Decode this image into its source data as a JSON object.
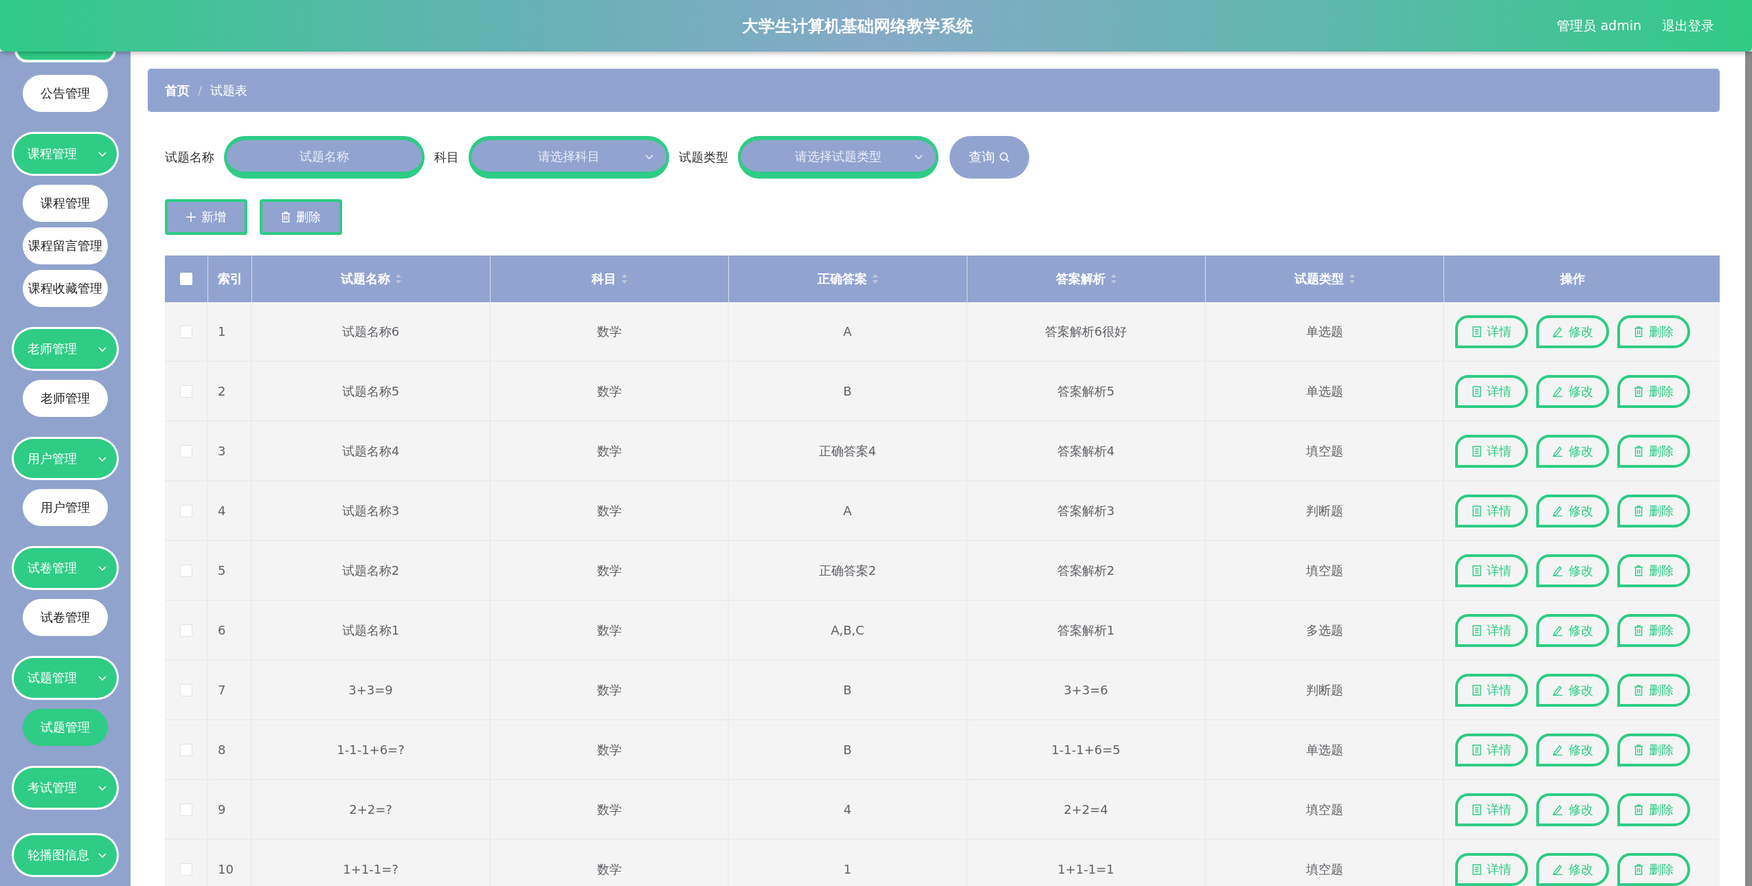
{
  "header": {
    "title": "大学生计算机基础网络教学系统",
    "user": "管理员 admin",
    "logout": "退出登录"
  },
  "sidebar": {
    "items": [
      {
        "kind": "item",
        "label": "公告管理",
        "selected": false
      },
      {
        "kind": "group",
        "label": "课程管理",
        "children": [
          {
            "label": "课程管理",
            "selected": false
          },
          {
            "label": "课程留言管理",
            "selected": false
          },
          {
            "label": "课程收藏管理",
            "selected": false
          }
        ]
      },
      {
        "kind": "group",
        "label": "老师管理",
        "children": [
          {
            "label": "老师管理",
            "selected": false
          }
        ]
      },
      {
        "kind": "group",
        "label": "用户管理",
        "children": [
          {
            "label": "用户管理",
            "selected": false
          }
        ]
      },
      {
        "kind": "group",
        "label": "试卷管理",
        "children": [
          {
            "label": "试卷管理",
            "selected": false
          }
        ]
      },
      {
        "kind": "group",
        "label": "试题管理",
        "children": [
          {
            "label": "试题管理",
            "selected": true
          }
        ]
      },
      {
        "kind": "group",
        "label": "考试管理"
      },
      {
        "kind": "group",
        "label": "轮播图信息"
      }
    ]
  },
  "breadcrumb": [
    {
      "label": "首页",
      "current": false
    },
    {
      "separator": "/",
      "label": "试题表",
      "current": true
    }
  ],
  "filters": [
    {
      "kind": "input",
      "label": "试题名称",
      "placeholder": "试题名称"
    },
    {
      "kind": "select",
      "label": "科目",
      "placeholder": "请选择科目"
    },
    {
      "kind": "select",
      "label": "试题类型",
      "placeholder": "请选择试题类型"
    }
  ],
  "search_button": "查询",
  "toolbar": [
    {
      "kind": "add",
      "label": "新增"
    },
    {
      "kind": "delete",
      "label": "删除"
    }
  ],
  "table": {
    "select_all": {
      "checked": false
    },
    "columns": [
      {
        "label": "索引",
        "sortable": false
      },
      {
        "label": "试题名称",
        "sortable": true
      },
      {
        "label": "科目",
        "sortable": true
      },
      {
        "label": "正确答案",
        "sortable": true
      },
      {
        "label": "答案解析",
        "sortable": true
      },
      {
        "label": "试题类型",
        "sortable": true
      },
      {
        "label": "操作",
        "sortable": false
      }
    ],
    "rows": [
      {
        "checked": false,
        "cells": [
          "1",
          "试题名称6",
          "数学",
          "A",
          "答案解析6很好",
          "单选题"
        ],
        "actions": [
          {
            "kind": "detail",
            "label": "详情"
          },
          {
            "kind": "edit",
            "label": "修改"
          },
          {
            "kind": "delete",
            "label": "删除"
          }
        ]
      },
      {
        "checked": false,
        "cells": [
          "2",
          "试题名称5",
          "数学",
          "B",
          "答案解析5",
          "单选题"
        ],
        "actions": [
          {
            "kind": "detail",
            "label": "详情"
          },
          {
            "kind": "edit",
            "label": "修改"
          },
          {
            "kind": "delete",
            "label": "删除"
          }
        ]
      },
      {
        "checked": false,
        "cells": [
          "3",
          "试题名称4",
          "数学",
          "正确答案4",
          "答案解析4",
          "填空题"
        ],
        "actions": [
          {
            "kind": "detail",
            "label": "详情"
          },
          {
            "kind": "edit",
            "label": "修改"
          },
          {
            "kind": "delete",
            "label": "删除"
          }
        ]
      },
      {
        "checked": false,
        "cells": [
          "4",
          "试题名称3",
          "数学",
          "A",
          "答案解析3",
          "判断题"
        ],
        "actions": [
          {
            "kind": "detail",
            "label": "详情"
          },
          {
            "kind": "edit",
            "label": "修改"
          },
          {
            "kind": "delete",
            "label": "删除"
          }
        ]
      },
      {
        "checked": false,
        "cells": [
          "5",
          "试题名称2",
          "数学",
          "正确答案2",
          "答案解析2",
          "填空题"
        ],
        "actions": [
          {
            "kind": "detail",
            "label": "详情"
          },
          {
            "kind": "edit",
            "label": "修改"
          },
          {
            "kind": "delete",
            "label": "删除"
          }
        ]
      },
      {
        "checked": false,
        "cells": [
          "6",
          "试题名称1",
          "数学",
          "A,B,C",
          "答案解析1",
          "多选题"
        ],
        "actions": [
          {
            "kind": "detail",
            "label": "详情"
          },
          {
            "kind": "edit",
            "label": "修改"
          },
          {
            "kind": "delete",
            "label": "删除"
          }
        ]
      },
      {
        "checked": false,
        "cells": [
          "7",
          "3+3=9",
          "数学",
          "B",
          "3+3=6",
          "判断题"
        ],
        "actions": [
          {
            "kind": "detail",
            "label": "详情"
          },
          {
            "kind": "edit",
            "label": "修改"
          },
          {
            "kind": "delete",
            "label": "删除"
          }
        ]
      },
      {
        "checked": false,
        "cells": [
          "8",
          "1-1-1+6=?",
          "数学",
          "B",
          "1-1-1+6=5",
          "单选题"
        ],
        "actions": [
          {
            "kind": "detail",
            "label": "详情"
          },
          {
            "kind": "edit",
            "label": "修改"
          },
          {
            "kind": "delete",
            "label": "删除"
          }
        ]
      },
      {
        "checked": false,
        "cells": [
          "9",
          "2+2=?",
          "数学",
          "4",
          "2+2=4",
          "填空题"
        ],
        "actions": [
          {
            "kind": "detail",
            "label": "详情"
          },
          {
            "kind": "edit",
            "label": "修改"
          },
          {
            "kind": "delete",
            "label": "删除"
          }
        ]
      },
      {
        "checked": false,
        "cells": [
          "10",
          "1+1-1=?",
          "数学",
          "1",
          "1+1-1=1",
          "填空题"
        ],
        "actions": [
          {
            "kind": "detail",
            "label": "详情"
          },
          {
            "kind": "edit",
            "label": "修改"
          },
          {
            "kind": "delete",
            "label": "删除"
          }
        ]
      }
    ]
  }
}
